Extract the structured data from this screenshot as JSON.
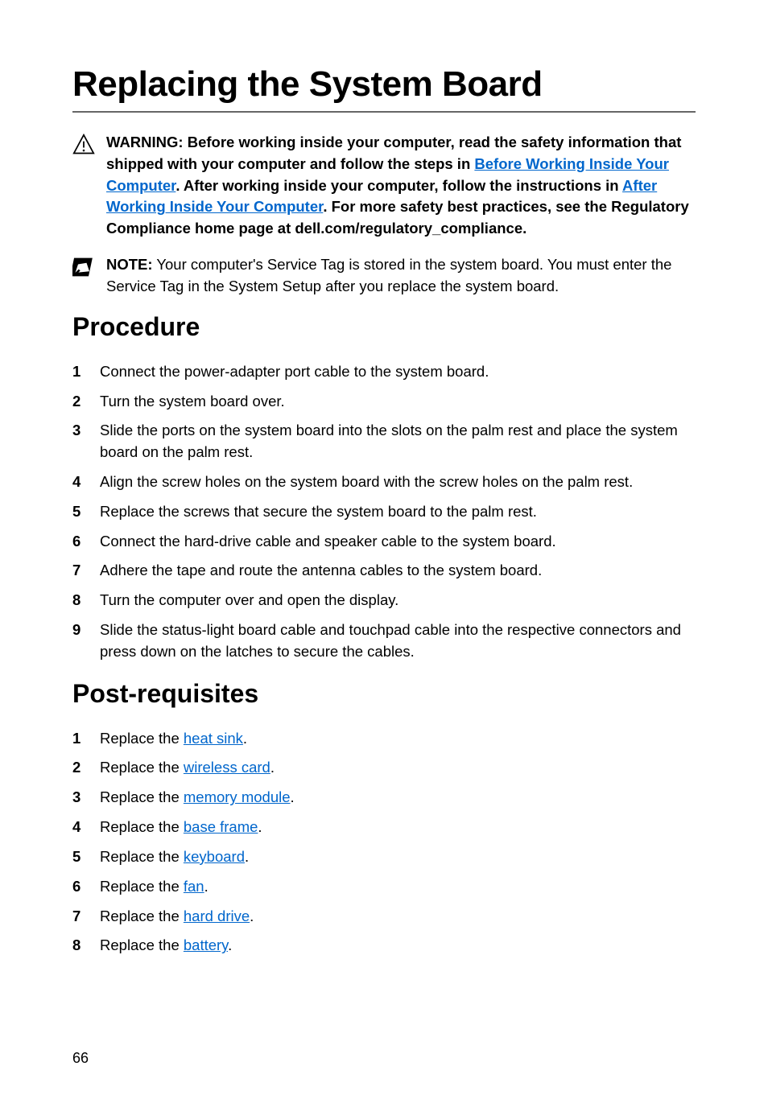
{
  "title": "Replacing the System Board",
  "warning": {
    "label": "WARNING:",
    "text1": " Before working inside your computer, read the safety information that shipped with your computer and follow the steps in ",
    "link1": "Before Working Inside Your Computer",
    "text2": ". After working inside your computer, follow the instructions in ",
    "link2": "After Working Inside Your Computer",
    "text3": ". For more safety best practices, see the Regulatory Compliance home page at dell.com/regulatory_compliance."
  },
  "note": {
    "label": "NOTE:",
    "text": " Your computer's Service Tag is stored in the system board. You must enter the Service Tag in the System Setup after you replace the system board."
  },
  "procedure": {
    "heading": "Procedure",
    "items": [
      "Connect the power-adapter port cable to the system board.",
      "Turn the system board over.",
      "Slide the ports on the system board into the slots on the palm rest and place the system board on the palm rest.",
      "Align the screw holes on the system board with the screw holes on the palm rest.",
      "Replace the screws that secure the system board to the palm rest.",
      "Connect the hard-drive cable and speaker cable to the system board.",
      "Adhere the tape and route the antenna cables to the system board.",
      "Turn the computer over and open the display.",
      "Slide the status-light board cable and touchpad cable into the respective connectors and press down on the latches to secure the cables."
    ]
  },
  "post": {
    "heading": "Post-requisites",
    "prefix": "Replace the ",
    "links": [
      "heat sink",
      "wireless card",
      "memory module",
      "base frame",
      "keyboard",
      "fan",
      "hard drive",
      "battery"
    ]
  },
  "page_number": "66"
}
